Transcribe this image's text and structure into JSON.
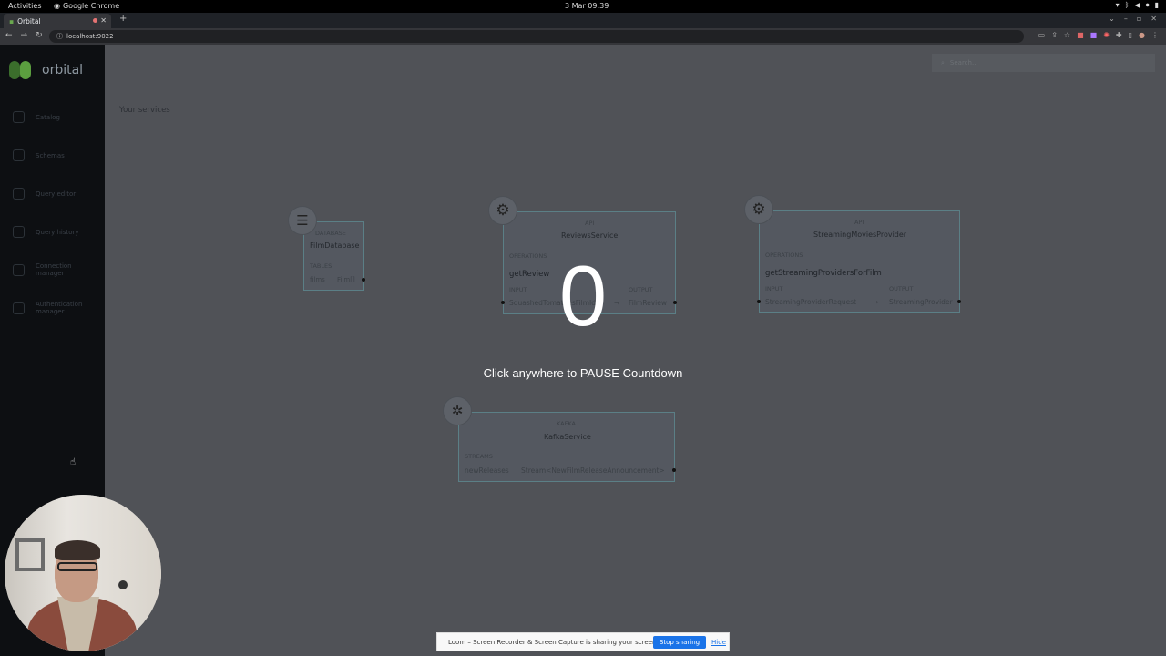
{
  "os": {
    "activities": "Activities",
    "app": "Google Chrome",
    "clock": "3 Mar  09:39"
  },
  "browser": {
    "tab_title": "Orbital",
    "url": "localhost:9022",
    "new_tab": "+"
  },
  "sidebar": {
    "brand": "orbital",
    "items": [
      {
        "label": "Catalog"
      },
      {
        "label": "Schemas"
      },
      {
        "label": "Query editor"
      },
      {
        "label": "Query history"
      },
      {
        "label": "Connection\nmanager"
      },
      {
        "label": "Authentication\nmanager"
      }
    ]
  },
  "main": {
    "search_placeholder": "Search...",
    "heading": "Your services"
  },
  "services": {
    "film_db": {
      "kind": "DATABASE",
      "name": "FilmDatabase",
      "section": "TABLES",
      "row_left": "films",
      "row_right": "Film[]"
    },
    "reviews": {
      "kind": "API",
      "name": "ReviewsService",
      "section": "OPERATIONS",
      "operation": "getReview",
      "input_label": "INPUT",
      "output_label": "OUTPUT",
      "input": "SquashedTomatoesFilmId",
      "arrow": "→",
      "output": "FilmReview"
    },
    "streaming": {
      "kind": "API",
      "name": "StreamingMoviesProvider",
      "section": "OPERATIONS",
      "operation": "getStreamingProvidersForFilm",
      "input_label": "INPUT",
      "output_label": "OUTPUT",
      "input": "StreamingProviderRequest",
      "arrow": "→",
      "output": "StreamingProvider"
    },
    "kafka": {
      "kind": "KAFKA",
      "name": "KafkaService",
      "section": "STREAMS",
      "stream": "newReleases",
      "stream_type": "Stream<NewFilmReleaseAnnouncement>"
    }
  },
  "overlay": {
    "countdown": "0",
    "message": "Click anywhere to PAUSE Countdown"
  },
  "sharebar": {
    "message": "Loom – Screen Recorder & Screen Capture is sharing your screen.",
    "stop": "Stop sharing",
    "hide": "Hide"
  }
}
